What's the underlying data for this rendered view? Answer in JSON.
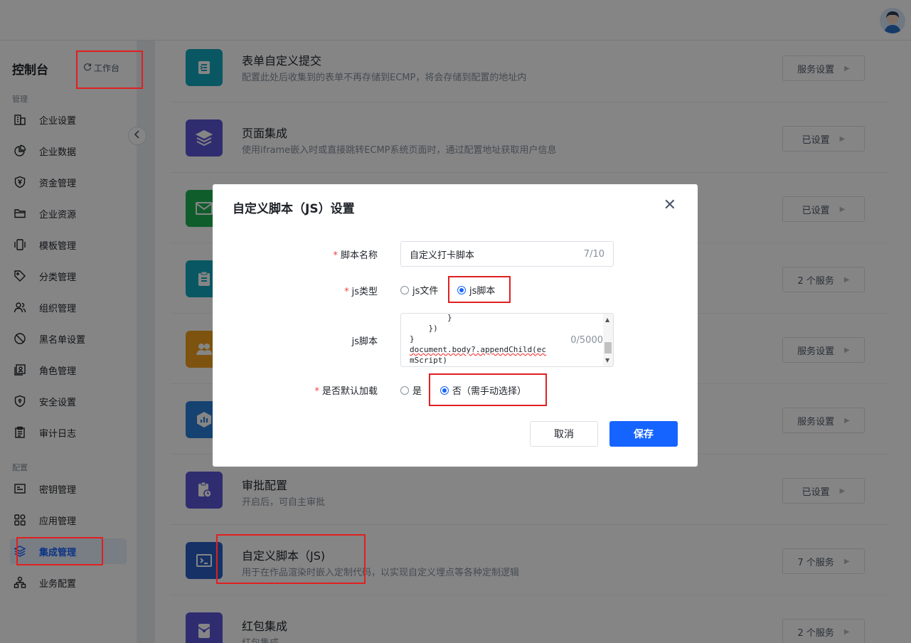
{
  "sidebar": {
    "title": "控制台",
    "workbench_label": "工作台",
    "section_manage": "管理",
    "section_config": "配置",
    "items": [
      {
        "label": "企业设置",
        "icon": "building-icon"
      },
      {
        "label": "企业数据",
        "icon": "pie-chart-icon"
      },
      {
        "label": "资金管理",
        "icon": "yen-shield-icon"
      },
      {
        "label": "企业资源",
        "icon": "folder-icon"
      },
      {
        "label": "模板管理",
        "icon": "template-icon"
      },
      {
        "label": "分类管理",
        "icon": "tag-icon"
      },
      {
        "label": "组织管理",
        "icon": "users-icon"
      },
      {
        "label": "黑名单设置",
        "icon": "ban-icon"
      },
      {
        "label": "角色管理",
        "icon": "role-icon"
      },
      {
        "label": "安全设置",
        "icon": "shield-icon"
      },
      {
        "label": "审计日志",
        "icon": "audit-log-icon"
      },
      {
        "label": "密钥管理",
        "icon": "key-card-icon"
      },
      {
        "label": "应用管理",
        "icon": "apps-icon"
      },
      {
        "label": "集成管理",
        "icon": "layers-icon"
      },
      {
        "label": "业务配置",
        "icon": "org-tree-icon"
      }
    ],
    "active_item": "集成管理"
  },
  "services": [
    {
      "title": "表单自定义提交",
      "desc": "配置此处后收集到的表单不再存储到ECMP，将会存储到配置的地址内",
      "button": "服务设置",
      "icon": "form-submit-icon",
      "color": "#13a8bf"
    },
    {
      "title": "页面集成",
      "desc": "使用iframe嵌入时或直接跳转ECMP系统页面时，通过配置地址获取用户信息",
      "button": "已设置",
      "icon": "stack-icon",
      "color": "#5b55d6"
    },
    {
      "title": "",
      "desc": "",
      "button": "已设置",
      "icon": "mail-icon",
      "color": "#1fb355"
    },
    {
      "title": "",
      "desc": "",
      "button": "2 个服务",
      "icon": "clipboard-icon",
      "color": "#13a8bf"
    },
    {
      "title": "",
      "desc": "",
      "button": "服务设置",
      "icon": "group-icon",
      "color": "#f0a01e"
    },
    {
      "title": "",
      "desc": "",
      "button": "服务设置",
      "icon": "hex-chart-icon",
      "color": "#2a7fd9"
    },
    {
      "title": "审批配置",
      "desc": "开启后，可自主审批",
      "button": "已设置",
      "icon": "approval-icon",
      "color": "#5b55d6"
    },
    {
      "title": "自定义脚本（JS)",
      "desc": "用于在作品渲染时嵌入定制代码，以实现自定义埋点等各种定制逻辑",
      "button": "7 个服务",
      "icon": "terminal-icon",
      "color": "#2a5fc4"
    },
    {
      "title": "红包集成",
      "desc": "红包集成",
      "button": "2 个服务",
      "icon": "red-packet-icon",
      "color": "#5b55d6"
    }
  ],
  "modal": {
    "title": "自定义脚本（JS）设置",
    "name_label": "脚本名称",
    "name_value": "自定义打卡脚本",
    "name_count": "7/10",
    "type_label": "js类型",
    "type_option_file": "js文件",
    "type_option_script": "js脚本",
    "type_selected": "js脚本",
    "script_label": "js脚本",
    "script_lines": [
      "        }",
      "    })",
      "}",
      "document.body?.appendChild(ec",
      "mScript)"
    ],
    "script_count": "0/5000",
    "default_label": "是否默认加载",
    "default_yes": "是",
    "default_no": "否（需手动选择）",
    "default_selected": "否（需手动选择）",
    "cancel_label": "取消",
    "save_label": "保存"
  },
  "colors": {
    "accent": "#1664ff",
    "required": "#f53f3f",
    "annotation": "#e02020"
  }
}
